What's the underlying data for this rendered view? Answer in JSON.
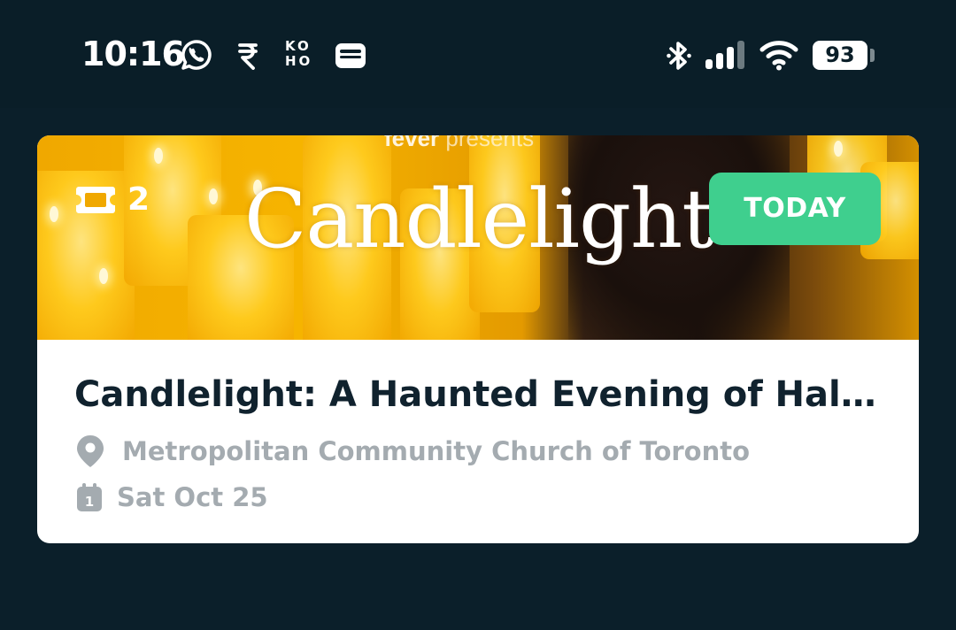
{
  "status_bar": {
    "time": "10:16",
    "notification_icons": [
      "whatsapp-icon",
      "rupee-icon",
      "koho-icon",
      "wallet-icon"
    ],
    "koho_line1": "KO",
    "koho_line2": "HO",
    "system_icons": [
      "bluetooth-icon",
      "signal-icon",
      "wifi-icon"
    ],
    "battery_level": "93"
  },
  "event_card": {
    "banner": {
      "presents_brand": "fever",
      "presents_text": "presents",
      "title": "Candlelight"
    },
    "ticket_count": "2",
    "badge": "TODAY",
    "badge_color": "#3fcf8e",
    "title": "Candlelight: A Haunted Evening of Hallo...",
    "venue": "Metropolitan Community Church of Toronto",
    "date": "Sat Oct 25",
    "calendar_day": "1"
  },
  "colors": {
    "background": "#0b1f2a",
    "title_text": "#10222e",
    "meta_text": "#a4abb0"
  }
}
